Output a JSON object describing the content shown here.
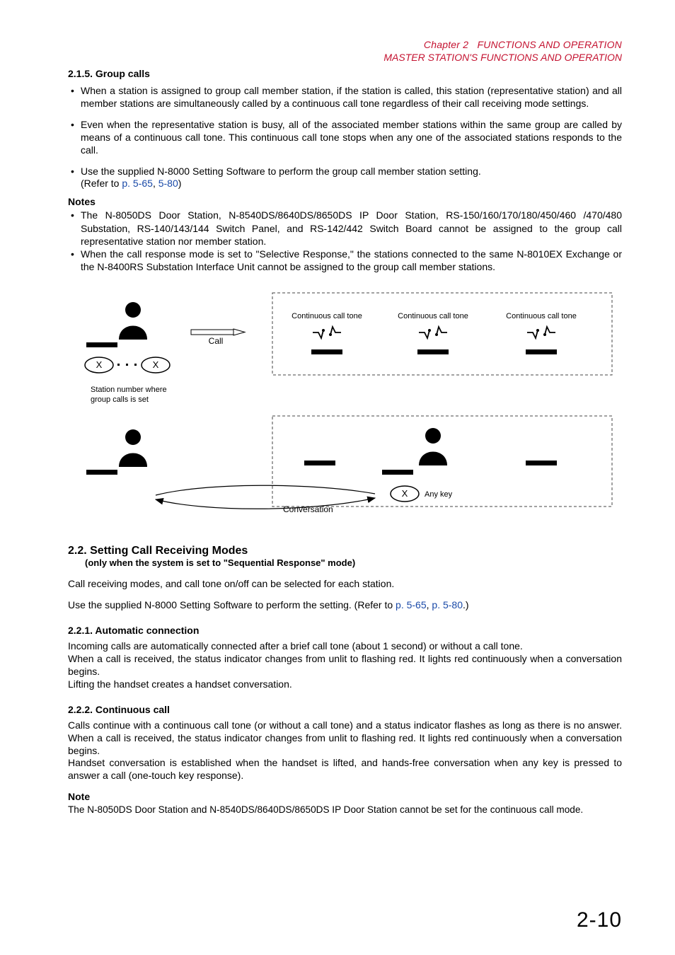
{
  "header": {
    "chapter_label": "Chapter 2",
    "chapter_title": "FUNCTIONS AND OPERATION",
    "subtitle": "MASTER STATION'S FUNCTIONS AND OPERATION"
  },
  "s215": {
    "heading": "2.1.5. Group calls",
    "bullets": [
      "When a station is assigned to group call member station, if the station is called, this station (representative station) and all member stations are simultaneously called by a continuous call tone regardless of their call receiving mode settings.",
      "Even when the representative station is busy, all of the associated member stations within the same group are called by means of a continuous call tone. This continuous call tone stops when any one of the associated stations responds to the call."
    ],
    "bullet3_pre": "Use the supplied N-8000 Setting Software to perform the group call member station setting.",
    "bullet3_ref_prefix": "(Refer to ",
    "bullet3_link1": "p. 5-65",
    "bullet3_sep": ", ",
    "bullet3_link2": "5-80",
    "bullet3_ref_suffix": ")",
    "notes_heading": "Notes",
    "notes": [
      "The N-8050DS Door Station, N-8540DS/8640DS/8650DS IP Door Station, RS-150/160/170/180/450/460 /470/480 Substation, RS-140/143/144 Switch Panel, and RS-142/442 Switch Board cannot be assigned to the group call representative station nor member station.",
      "When the call response mode is set to \"Selective Response,\" the stations connected to the same N-8010EX Exchange or the N-8400RS Substation Interface Unit cannot be assigned to the group call member stations."
    ]
  },
  "figure": {
    "continuous_label": "Continuous call tone",
    "call_label": "Call",
    "x_label": "X",
    "station_caption_l1": "Station number where",
    "station_caption_l2": "group calls is set",
    "conversation_label": "Conversation",
    "anykey_label": "Any key"
  },
  "s22": {
    "heading": "2.2. Setting Call Receiving Modes",
    "subheading": "(only when the system is set to \"Sequential Response\" mode)",
    "p1": "Call receiving modes, and call tone on/off can be selected for each station.",
    "p2_pre": "Use the supplied N-8000 Setting Software to perform the setting. (Refer to ",
    "p2_link1": "p. 5-65",
    "p2_sep": ", ",
    "p2_link2": "p. 5-80",
    "p2_suffix": ".)"
  },
  "s221": {
    "heading": "2.2.1. Automatic connection",
    "p1": "Incoming calls are automatically connected after a brief call tone (about 1 second) or without a call tone.",
    "p2": "When a call is received, the status indicator changes from unlit to flashing red. It lights red continuously when a conversation begins.",
    "p3": "Lifting the handset creates a handset conversation."
  },
  "s222": {
    "heading": "2.2.2. Continuous call",
    "p1": "Calls continue with a continuous call tone (or without a call tone) and a status indicator flashes as long as there is no answer. When a call is received, the status indicator changes from unlit to flashing red. It lights red continuously when a conversation begins.",
    "p2": "Handset conversation is established when the handset is lifted, and hands-free conversation when any key is pressed to answer a call (one-touch key response).",
    "note_heading": "Note",
    "note_text": "The N-8050DS Door Station and N-8540DS/8640DS/8650DS IP Door Station cannot be set for the continuous call mode."
  },
  "pagenum": "2-10"
}
